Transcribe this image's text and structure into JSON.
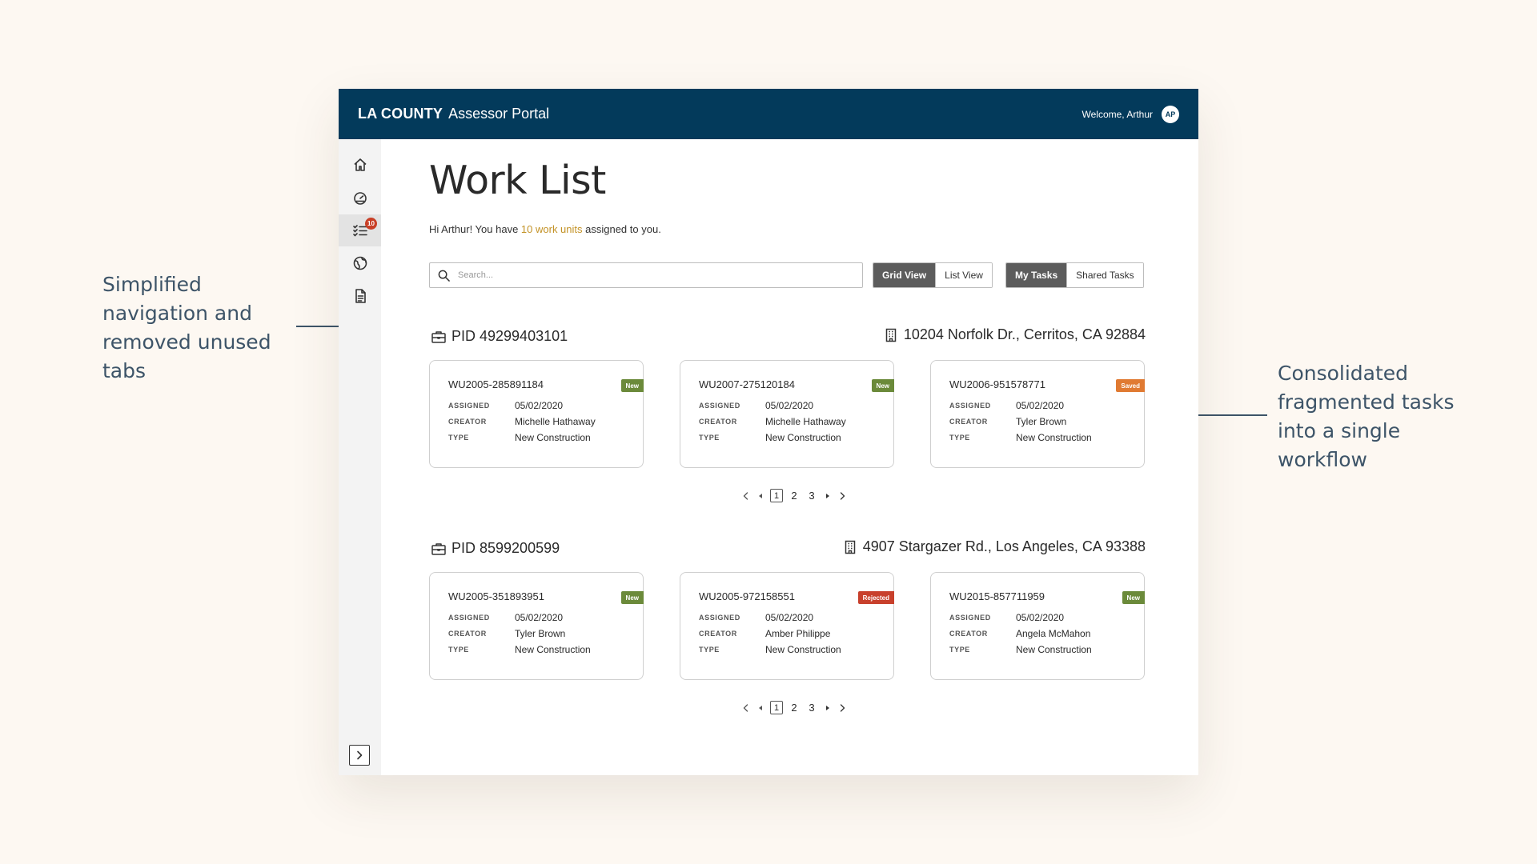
{
  "annotations": {
    "left": "Simplified navigation and removed unused tabs",
    "right": "Consolidated fragmented tasks into a single workflow"
  },
  "header": {
    "brand_bold": "LA COUNTY",
    "brand_light": "Assessor Portal",
    "welcome": "Welcome, Arthur",
    "avatar_initials": "AP"
  },
  "sidebar": {
    "items": [
      {
        "name": "home",
        "icon": "home-icon"
      },
      {
        "name": "dashboard",
        "icon": "speedometer-icon"
      },
      {
        "name": "work-list",
        "icon": "checklist-icon",
        "badge": "10",
        "active": true
      },
      {
        "name": "map",
        "icon": "globe-icon"
      },
      {
        "name": "documents",
        "icon": "document-icon"
      }
    ],
    "expand_icon": "chevron-right-icon"
  },
  "main": {
    "title": "Work List",
    "greeting_prefix": "Hi Arthur! You have ",
    "greeting_count": "10 work units",
    "greeting_suffix": " assigned to you.",
    "search_placeholder": "Search...",
    "view_toggle": {
      "grid": "Grid View",
      "list": "List View"
    },
    "task_toggle": {
      "mine": "My Tasks",
      "shared": "Shared Tasks"
    }
  },
  "labels": {
    "assigned": "ASSIGNED",
    "creator": "CREATOR",
    "type": "TYPE"
  },
  "groups": [
    {
      "pid": "PID 49299403101",
      "address": "10204 Norfolk Dr., Cerritos, CA 92884",
      "pages": [
        "1",
        "2",
        "3"
      ],
      "cards": [
        {
          "id": "WU2005-285891184",
          "status": "New",
          "assigned": "05/02/2020",
          "creator": "Michelle Hathaway",
          "type": "New Construction"
        },
        {
          "id": "WU2007-275120184",
          "status": "New",
          "assigned": "05/02/2020",
          "creator": "Michelle Hathaway",
          "type": "New Construction"
        },
        {
          "id": "WU2006-951578771",
          "status": "Saved",
          "assigned": "05/02/2020",
          "creator": "Tyler Brown",
          "type": "New Construction"
        }
      ]
    },
    {
      "pid": "PID 8599200599",
      "address": "4907 Stargazer Rd., Los Angeles, CA 93388",
      "pages": [
        "1",
        "2",
        "3"
      ],
      "cards": [
        {
          "id": "WU2005-351893951",
          "status": "New",
          "assigned": "05/02/2020",
          "creator": "Tyler Brown",
          "type": "New Construction"
        },
        {
          "id": "WU2005-972158551",
          "status": "Rejected",
          "assigned": "05/02/2020",
          "creator": "Amber Philippe",
          "type": "New Construction"
        },
        {
          "id": "WU2015-857711959",
          "status": "New",
          "assigned": "05/02/2020",
          "creator": "Angela McMahon",
          "type": "New Construction"
        }
      ]
    }
  ],
  "colors": {
    "header_bg": "#033a5b",
    "accent_count": "#c39226",
    "status_new": "#6b8a3a",
    "status_saved": "#e07a32",
    "status_rejected": "#c8402c",
    "badge": "#c83f26"
  }
}
